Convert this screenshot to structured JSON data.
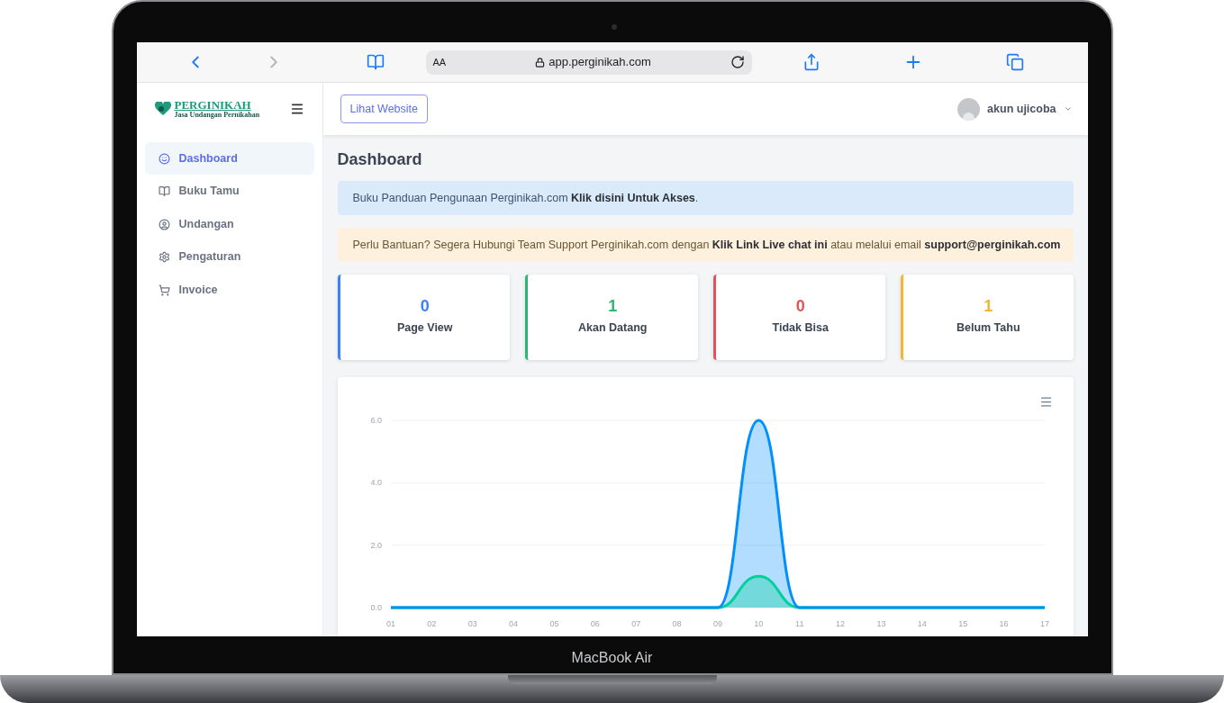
{
  "device": {
    "label": "MacBook Air"
  },
  "browser": {
    "text_size": "AA",
    "url": "app.perginikah.com",
    "forward_disabled": true
  },
  "sidebar": {
    "logo": {
      "title": "PERGINIKAH",
      "subtitle": "Jasa Undangan Pernikahan"
    },
    "items": [
      {
        "label": "Dashboard",
        "selected": true
      },
      {
        "label": "Buku Tamu",
        "selected": false
      },
      {
        "label": "Undangan",
        "selected": false
      },
      {
        "label": "Pengaturan",
        "selected": false
      },
      {
        "label": "Invoice",
        "selected": false
      }
    ]
  },
  "header": {
    "button": "Lihat Website",
    "user": "akun ujicoba"
  },
  "page_title": "Dashboard",
  "alerts": [
    {
      "kind": "info",
      "text": "Buku Panduan Pengunaan Perginikah.com **Klik disini Untuk Akses**."
    },
    {
      "kind": "warning",
      "text": "Perlu Bantuan? Segera Hubungi Team Support Perginikah.com dengan **Klik Link Live chat ini** atau melalui email **support@perginikah.com**"
    }
  ],
  "stats": [
    {
      "value": "0",
      "label": "Page View",
      "color": "#3b82f6"
    },
    {
      "value": "1",
      "label": "Akan Datang",
      "color": "#2fb672"
    },
    {
      "value": "0",
      "label": "Tidak Bisa",
      "color": "#e3525c"
    },
    {
      "value": "1",
      "label": "Belum Tahu",
      "color": "#f2b634"
    }
  ],
  "chart": {
    "chart_data": {
      "type": "area",
      "categories": [
        "01",
        "02",
        "03",
        "04",
        "05",
        "06",
        "07",
        "08",
        "09",
        "10",
        "11",
        "12",
        "13",
        "14",
        "15",
        "16",
        "17"
      ],
      "series": [
        {
          "color": "#008ffb",
          "values": [
            0,
            0,
            0,
            0,
            0,
            0,
            0,
            0,
            0,
            6,
            0,
            0,
            0,
            0,
            0,
            0,
            0
          ]
        },
        {
          "color": "#00d09a",
          "values": [
            0,
            0,
            0,
            0,
            0,
            0,
            0,
            0,
            0,
            1,
            0,
            0,
            0,
            0,
            0,
            0,
            0
          ]
        }
      ],
      "ylim": [
        0,
        6
      ],
      "yticks": [
        {
          "value": 0,
          "label": "0.0"
        },
        {
          "value": 2,
          "label": "2.0"
        },
        {
          "value": 4,
          "label": "4.0"
        },
        {
          "value": 6,
          "label": "6.0"
        }
      ]
    }
  }
}
